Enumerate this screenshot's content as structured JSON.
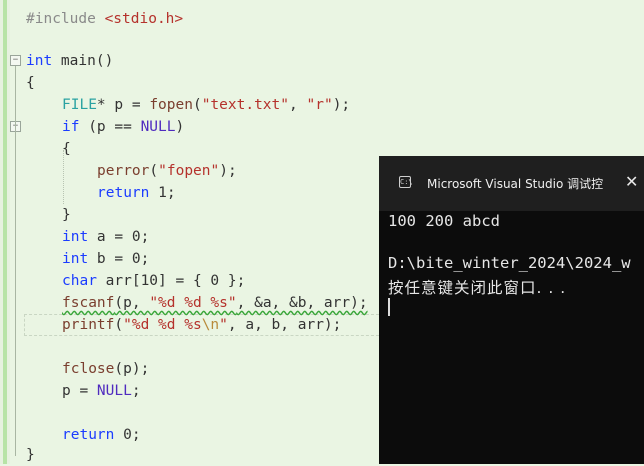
{
  "editor": {
    "lines": {
      "l1": {
        "pp": "#include ",
        "hdr": "<stdio.h>"
      },
      "l3": {
        "kw": "int",
        "rest": " main()"
      },
      "l4": "{",
      "l5": {
        "ty": "FILE",
        "a": "* p = ",
        "fn": "fopen",
        "b": "(",
        "s1": "\"text.txt\"",
        "c": ", ",
        "s2": "\"r\"",
        "d": ");"
      },
      "l6": {
        "kw": "if",
        "a": " (p == ",
        "mac": "NULL",
        "b": ")"
      },
      "l7": "{",
      "l8": {
        "fn": "perror",
        "a": "(",
        "s": "\"fopen\"",
        "b": ");"
      },
      "l9": {
        "kw": "return",
        "a": " 1;"
      },
      "l10": "}",
      "l11": {
        "kw": "int",
        "a": " a = 0;"
      },
      "l12": {
        "kw": "int",
        "a": " b = 0;"
      },
      "l13": {
        "kw": "char",
        "a": " arr[10] = { 0 };"
      },
      "l14": {
        "fn": "fscanf",
        "a": "(p, ",
        "s": "\"%d %d %s\"",
        "b": ", &a, &b, arr);"
      },
      "l15": {
        "fn": "printf",
        "a": "(",
        "s1": "\"%d %d %s",
        "esc": "\\n",
        "s2": "\"",
        "b": ", a, b, arr);"
      },
      "l17": {
        "fn": "fclose",
        "a": "(p);"
      },
      "l18": {
        "a": "p = ",
        "mac": "NULL",
        "b": ";"
      },
      "l20": {
        "kw": "return",
        "a": " 0;"
      },
      "l21": "}"
    }
  },
  "console": {
    "title": "Microsoft Visual Studio 调试控",
    "close": "✕",
    "output": [
      "100 200 abcd",
      "D:\\bite_winter_2024\\2024_w",
      "按任意键关闭此窗口. . ."
    ]
  },
  "icons": {
    "console_icon": "console-app-icon",
    "fold_icon": "collapse-icon"
  }
}
